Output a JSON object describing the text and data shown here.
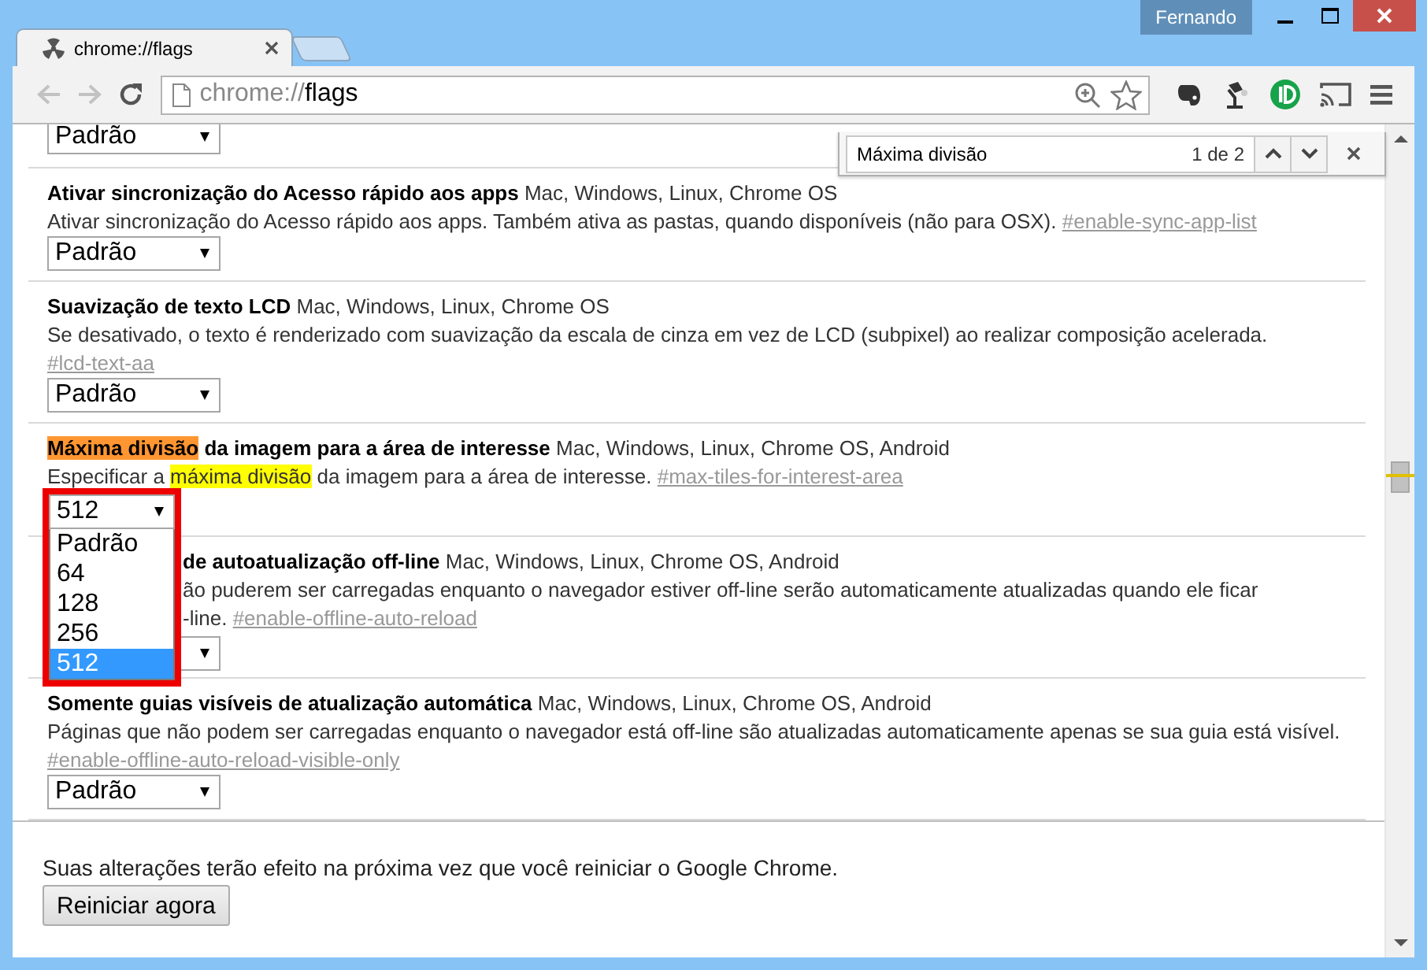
{
  "window": {
    "user": "Fernando"
  },
  "tabs": [
    {
      "title": "chrome://flags",
      "selected": true
    }
  ],
  "omnibox": {
    "scheme": "chrome://",
    "path": "flags"
  },
  "find_bar": {
    "query": "Máxima divisão",
    "count": "1 de 2"
  },
  "top_select": {
    "value": "Padrão"
  },
  "experiments": [
    {
      "kind": "normal",
      "title": [
        {
          "text": "Ativar sincronização do Acesso rápido aos apps",
          "kind": "plain"
        }
      ],
      "platforms": "Mac, Windows, Linux, Chrome OS",
      "description": [
        {
          "text": "Ativar sincronização do Acesso rápido aos apps. Também ativa as pastas, quando disponíveis (não para OSX).",
          "kind": "plain"
        }
      ],
      "link": "#enable-sync-app-list",
      "select": {
        "value": "Padrão",
        "open": false
      }
    },
    {
      "kind": "normal",
      "title": [
        {
          "text": "Suavização de texto LCD",
          "kind": "plain"
        }
      ],
      "platforms": "Mac, Windows, Linux, Chrome OS",
      "description": [
        {
          "text": "Se desativado, o texto é renderizado com suavização da escala de cinza em vez de LCD (subpixel) ao realizar composição acelerada.",
          "kind": "plain"
        }
      ],
      "link": "#lcd-text-aa",
      "select": {
        "value": "Padrão",
        "open": false
      }
    },
    {
      "kind": "normal",
      "title": [
        {
          "text": "Máxima divisão",
          "kind": "current"
        },
        {
          "text": " da imagem para a área de interesse",
          "kind": "plain"
        }
      ],
      "platforms": "Mac, Windows, Linux, Chrome OS, Android",
      "description": [
        {
          "text": "Especificar a ",
          "kind": "plain"
        },
        {
          "text": "máxima divisão",
          "kind": "match"
        },
        {
          "text": " da imagem para a área de interesse.",
          "kind": "plain"
        }
      ],
      "link": "#max-tiles-for-interest-area",
      "select": {
        "value": "512",
        "open": true,
        "options": [
          {
            "label": "Padrão",
            "selected": false
          },
          {
            "label": "64",
            "selected": false
          },
          {
            "label": "128",
            "selected": false
          },
          {
            "label": "256",
            "selected": false
          },
          {
            "label": "512",
            "selected": true
          }
        ]
      }
    },
    {
      "kind": "covered",
      "title": [
        {
          "text": "de autoatualização off-line",
          "kind": "plain"
        }
      ],
      "platforms": "Mac, Windows, Linux, Chrome OS, Android",
      "description": [
        {
          "text": "ão puderem ser carregadas enquanto o navegador estiver off-line serão automaticamente atualizadas quando ele ficar\n-line.",
          "kind": "plain"
        }
      ],
      "link": "#enable-offline-auto-reload"
    },
    {
      "kind": "normal",
      "title": [
        {
          "text": "Somente guias visíveis de atualização automática",
          "kind": "plain"
        }
      ],
      "platforms": "Mac, Windows, Linux, Chrome OS, Android",
      "description": [
        {
          "text": "Páginas que não podem ser carregadas enquanto o navegador está off-line são atualizadas automaticamente apenas se sua guia está visível.",
          "kind": "plain"
        }
      ],
      "link": "#enable-offline-auto-reload-visible-only",
      "select": {
        "value": "Padrão",
        "open": false
      }
    }
  ],
  "footer": {
    "message": "Suas alterações terão efeito na próxima vez que você reiniciar o Google Chrome.",
    "button": "Reiniciar agora"
  }
}
